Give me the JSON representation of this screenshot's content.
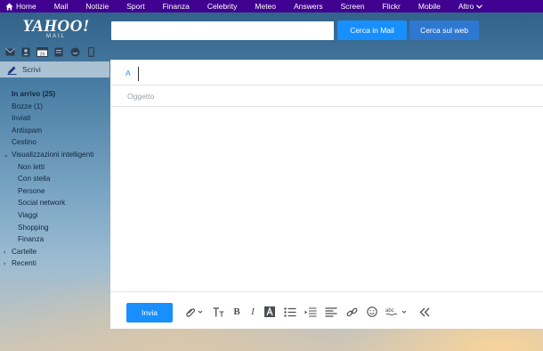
{
  "topnav": {
    "items": [
      "Home",
      "Mail",
      "Notizie",
      "Sport",
      "Finanza",
      "Celebrity",
      "Meteo",
      "Answers",
      "Screen",
      "Flickr",
      "Mobile",
      "Altro"
    ]
  },
  "logo": {
    "main": "YAHOO!",
    "sub": "MAIL"
  },
  "search": {
    "value": "",
    "btn_mail": "Cerca in Mail",
    "btn_web": "Cerca sul web"
  },
  "app_icons": [
    "mail-icon",
    "contacts-icon",
    "calendar-icon",
    "notepad-icon",
    "messenger-icon",
    "mobile-icon"
  ],
  "app_icon_calendar_day": "26",
  "compose_button": "Scrivi",
  "folders": {
    "inbox": "In arrivo (25)",
    "drafts": "Bozze (1)",
    "sent": "Inviati",
    "spam": "Antispam",
    "trash": "Cestino",
    "smart_views": "Visualizzazioni intelligenti",
    "smart": [
      "Non letti",
      "Con stella",
      "Persone",
      "Social network",
      "Viaggi",
      "Shopping",
      "Finanza"
    ],
    "folders_group": "Cartelle",
    "recent_group": "Recenti"
  },
  "compose": {
    "to_label": "A",
    "to_value": "",
    "subject_placeholder": "Oggetto",
    "send": "Invia",
    "spellcheck_label": "abc"
  },
  "tools": [
    "attachment-icon",
    "font-size-icon",
    "bold-icon",
    "italic-icon",
    "text-color-icon",
    "bullet-list-icon",
    "indent-icon",
    "align-icon",
    "link-icon",
    "emoji-icon",
    "spellcheck-icon",
    "collapse-icon"
  ],
  "colors": {
    "nav": "#400090",
    "accent": "#188fff",
    "web_button": "#2e78d2"
  }
}
